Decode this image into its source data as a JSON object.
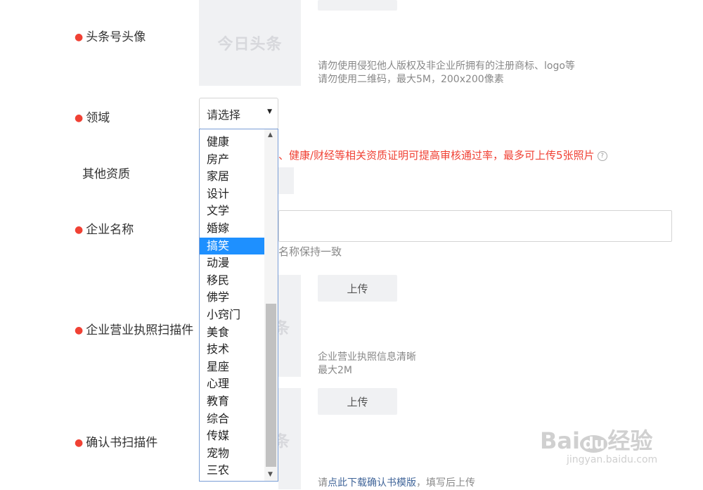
{
  "fields": {
    "avatar": {
      "label": "头条号头像",
      "placeholder_logo": "今日头条",
      "upload": "上传",
      "hint1": "请勿使用侵犯他人版权及非企业所拥有的注册商标、logo等",
      "hint2": "请勿使用二维码，最大5M，200x200像素"
    },
    "domain": {
      "label": "领域",
      "select_value": "请选择"
    },
    "other": {
      "label": "其他资质",
      "note_visible": "、健康/财经等相关资质证明可提高审核通过率，最多可上传5张照片"
    },
    "company": {
      "label": "企业名称",
      "hint_visible": "名称保持一致"
    },
    "license": {
      "label": "企业营业执照扫描件",
      "upload": "上传",
      "hint1": "企业营业执照信息清晰",
      "hint2": "最大2M",
      "logo_fragment": "条"
    },
    "confirm": {
      "label": "确认书扫描件",
      "upload": "上传",
      "hint_prefix": "请",
      "hint_link": "点此下载确认书模版",
      "hint_suffix": "，填写后上传",
      "logo_fragment": "条"
    }
  },
  "dropdown": {
    "options": [
      "健康",
      "房产",
      "家居",
      "设计",
      "文学",
      "婚嫁",
      "搞笑",
      "动漫",
      "移民",
      "佛学",
      "小窍门",
      "美食",
      "技术",
      "星座",
      "心理",
      "教育",
      "综合",
      "传媒",
      "宠物",
      "三农"
    ],
    "selected": "搞笑"
  },
  "watermark": {
    "brand": "Bai",
    "du": "du",
    "cn": "经验",
    "url": "jingyan.baidu.com"
  },
  "colors": {
    "required": "#f04134",
    "selected_bg": "#1e90ff",
    "link": "#406599"
  }
}
